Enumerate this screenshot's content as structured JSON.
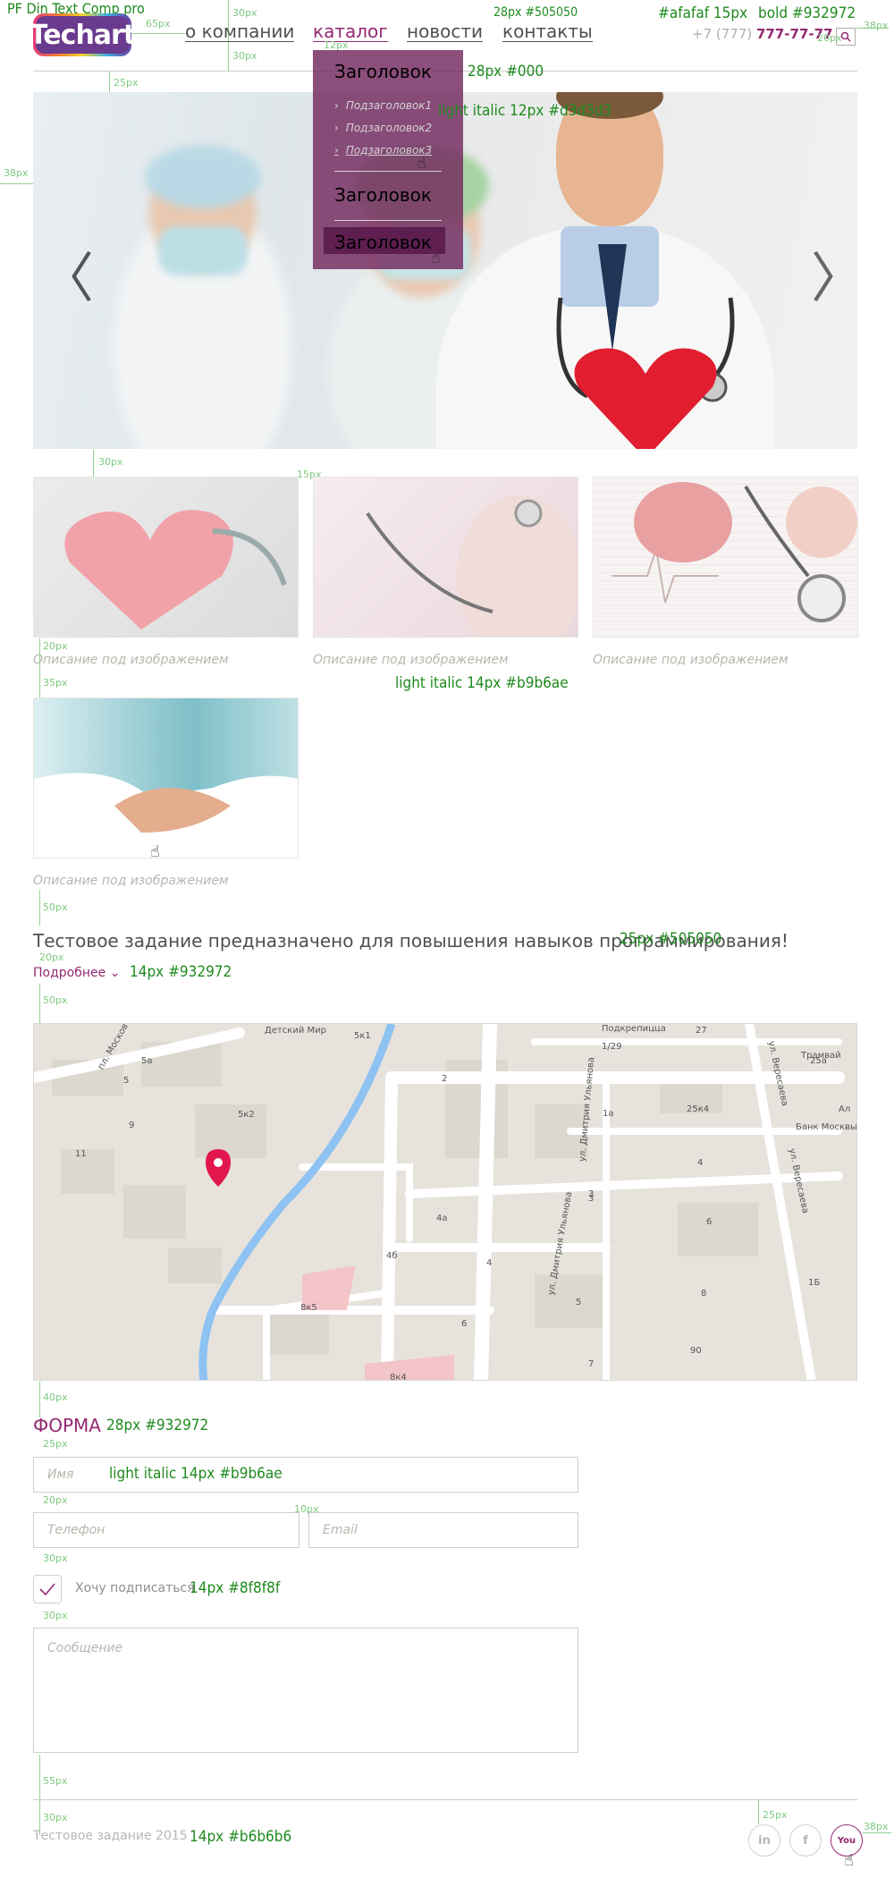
{
  "annotations": {
    "font_name": "PF Din Text Comp pro",
    "spec_phone_gray": "#afafaf 15px",
    "spec_phone_bold": "bold #932972",
    "spec_nav": "28px #505050",
    "spec_dropdown_head": "28px #000",
    "spec_dropdown_sub": "light italic 12px #d3d3d3",
    "spec_caption": "light italic 14px #b9b6ae",
    "spec_lead": "25px #505050",
    "spec_more": "14px #932972",
    "spec_form_title": "28px #932972",
    "spec_field": "light italic 14px #b9b6ae",
    "spec_check": "14px #8f8f8f",
    "spec_footer": "14px #b6b6b6",
    "m_65": "65px",
    "m_30a": "30px",
    "m_30b": "30px",
    "m_12": "12px",
    "m_20": "20px",
    "m_38a": "38px",
    "m_25": "25px",
    "m_38b": "38px",
    "m_30c": "30px",
    "m_15": "15px",
    "m_20b": "20px",
    "m_35": "35px",
    "m_50a": "50px",
    "m_20c": "20px",
    "m_50b": "50px",
    "m_40": "40px",
    "m_25b": "25px",
    "m_20d": "20px",
    "m_10": "10px",
    "m_30d": "30px",
    "m_30e": "30px",
    "m_55": "55px",
    "m_30f": "30px",
    "m_25c": "25px",
    "m_38c": "38px"
  },
  "header": {
    "logo": "Techart",
    "nav": [
      {
        "label": "о компании"
      },
      {
        "label": "каталог"
      },
      {
        "label": "новости"
      },
      {
        "label": "контакты"
      }
    ],
    "phone_prefix": "+7 (777)",
    "phone_number": "777-77-77",
    "search_icon": "search-icon"
  },
  "dropdown": {
    "heading1": "Заголовок",
    "subitems": [
      {
        "label": "Подзаголовок1"
      },
      {
        "label": "Подзаголовок2"
      },
      {
        "label": "Подзаголовок3"
      }
    ],
    "heading2": "Заголовок",
    "heading3": "Заголовок"
  },
  "slider": {
    "prev_icon": "chevron-left-icon",
    "next_icon": "chevron-right-icon",
    "prev_glyph": "〈",
    "next_glyph": "〉"
  },
  "gallery": {
    "captions": [
      "Описание под изображением",
      "Описание под изображением",
      "Описание под изображением",
      "Описание под изображением"
    ]
  },
  "intro": {
    "lead": "Тестовое задание предназначено для повышения навыков программирования!",
    "more": "Подробнее"
  },
  "map": {
    "labels": [
      "Детский Мир",
      "пл. Москов",
      "5к1",
      "5a",
      "5",
      "9",
      "5к2",
      "11",
      "2",
      "1/29",
      "Подкрепицца",
      "27",
      "ул. Вересаева",
      "Трамвай",
      "1a",
      "25к4",
      "Банк Москвы",
      "Ал",
      "3",
      "4",
      "4a",
      "4б",
      "6",
      "ул. Дмитрия Ульянова",
      "ул. Дмитрия Ульянова",
      "5",
      "8",
      "1Б",
      "90",
      "7",
      "8к5",
      "6",
      "8к4",
      "25a",
      "ул. Вересаева",
      "4",
      "3"
    ]
  },
  "form": {
    "title": "ФОРМА",
    "name_placeholder": "Имя",
    "phone_placeholder": "Телефон",
    "email_placeholder": "Email",
    "subscribe_label": "Хочу подписаться",
    "subscribe_checked": true,
    "message_placeholder": "Сообщение"
  },
  "footer": {
    "copyright": "Тестовое задание 2015",
    "social": [
      {
        "label": "in",
        "icon": "linkedin-icon"
      },
      {
        "label": "f",
        "icon": "facebook-icon"
      },
      {
        "label": "You",
        "icon": "youtube-icon"
      }
    ]
  },
  "colors": {
    "brand": "#932972",
    "text": "#505050",
    "gray": "#afafaf",
    "caption": "#b9b6ae",
    "spec": "#1e8a1e"
  }
}
